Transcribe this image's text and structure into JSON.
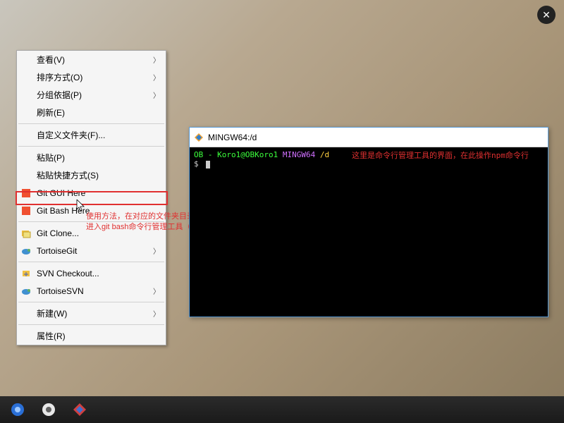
{
  "close_button": "✕",
  "context_menu": {
    "items": [
      {
        "label": "查看(V)",
        "submenu": true,
        "icon": ""
      },
      {
        "label": "排序方式(O)",
        "submenu": true,
        "icon": ""
      },
      {
        "label": "分组依据(P)",
        "submenu": true,
        "icon": ""
      },
      {
        "label": "刷新(E)",
        "submenu": false,
        "icon": ""
      },
      {
        "sep": true
      },
      {
        "label": "自定义文件夹(F)...",
        "submenu": false,
        "icon": ""
      },
      {
        "sep": true
      },
      {
        "label": "粘贴(P)",
        "submenu": false,
        "icon": ""
      },
      {
        "label": "粘贴快捷方式(S)",
        "submenu": false,
        "icon": ""
      },
      {
        "label": "Git GUI Here",
        "submenu": false,
        "icon": "git-gui"
      },
      {
        "label": "Git Bash Here",
        "submenu": false,
        "icon": "git-bash",
        "highlighted": true
      },
      {
        "sep": true
      },
      {
        "label": "Git Clone...",
        "submenu": false,
        "icon": "git-clone"
      },
      {
        "label": "TortoiseGit",
        "submenu": true,
        "icon": "tortoise-git"
      },
      {
        "sep": true
      },
      {
        "label": "SVN Checkout...",
        "submenu": false,
        "icon": "svn-checkout"
      },
      {
        "label": "TortoiseSVN",
        "submenu": true,
        "icon": "tortoise-svn"
      },
      {
        "sep": true
      },
      {
        "label": "新建(W)",
        "submenu": true,
        "icon": ""
      },
      {
        "sep": true
      },
      {
        "label": "属性(R)",
        "submenu": false,
        "icon": ""
      }
    ]
  },
  "annotations": {
    "left_line1": "使用方法，在对应的文件夹目录，点击鼠标右键，",
    "left_line2": "进入git bash命令行管理工具（如右所示）",
    "right": "这里是命令行管理工具的界面，在此操作npm命令行"
  },
  "terminal": {
    "title": "MINGW64:/d",
    "prompt_user": "OB",
    "prompt_sep": " - ",
    "prompt_host": "Koro1@OBKoro1",
    "prompt_env": "MINGW64",
    "prompt_path": "/d",
    "prompt_symbol": "$"
  },
  "taskbar": {
    "icons": [
      "start",
      "browser",
      "tool"
    ]
  }
}
